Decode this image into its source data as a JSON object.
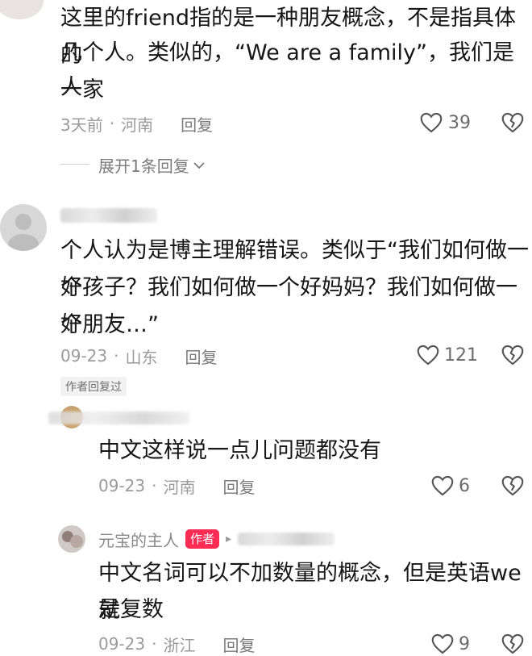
{
  "comments": [
    {
      "text": "这里的friend指的是一种朋友概念，不是指具体的几个人。类似的，“We are a family”，我们是一家人",
      "line1": "这里的friend指的是一种朋友概念，不是指具体的",
      "line2": "几个人。类似的，“We are a family”，我们是一家",
      "line3": "人",
      "time": "3天前",
      "dot": "·",
      "location": "河南",
      "reply_label": "回复",
      "likes": "39",
      "expand_label": "展开1条回复"
    },
    {
      "line1": "个人认为是博主理解错误。类似于“我们如何做一个",
      "line2": "好孩子？我们如何做一个好妈妈？我们如何做一个",
      "line3": "好朋友…”",
      "time": "09-23",
      "dot": "·",
      "location": "山东",
      "reply_label": "回复",
      "likes": "121",
      "author_replied_tag": "作者回复过"
    }
  ],
  "replies": [
    {
      "text": "中文这样说一点儿问题都没有",
      "time": "09-23",
      "dot": "·",
      "location": "河南",
      "reply_label": "回复",
      "likes": "6"
    },
    {
      "username": "元宝的主人",
      "author_badge": "作者",
      "reply_arrow": "▸",
      "line1": "中文名词可以不加数量的概念，但是英语we就",
      "line2": "是复数",
      "time": "09-23",
      "dot": "·",
      "location": "浙江",
      "reply_label": "回复",
      "likes": "9"
    }
  ],
  "colors": {
    "accent": "#fe2c55",
    "meta": "#9a9a9a",
    "text": "#161616"
  },
  "icons": {
    "like": "heart-icon",
    "dislike": "broken-heart-icon",
    "expand": "chevron-down-icon"
  }
}
